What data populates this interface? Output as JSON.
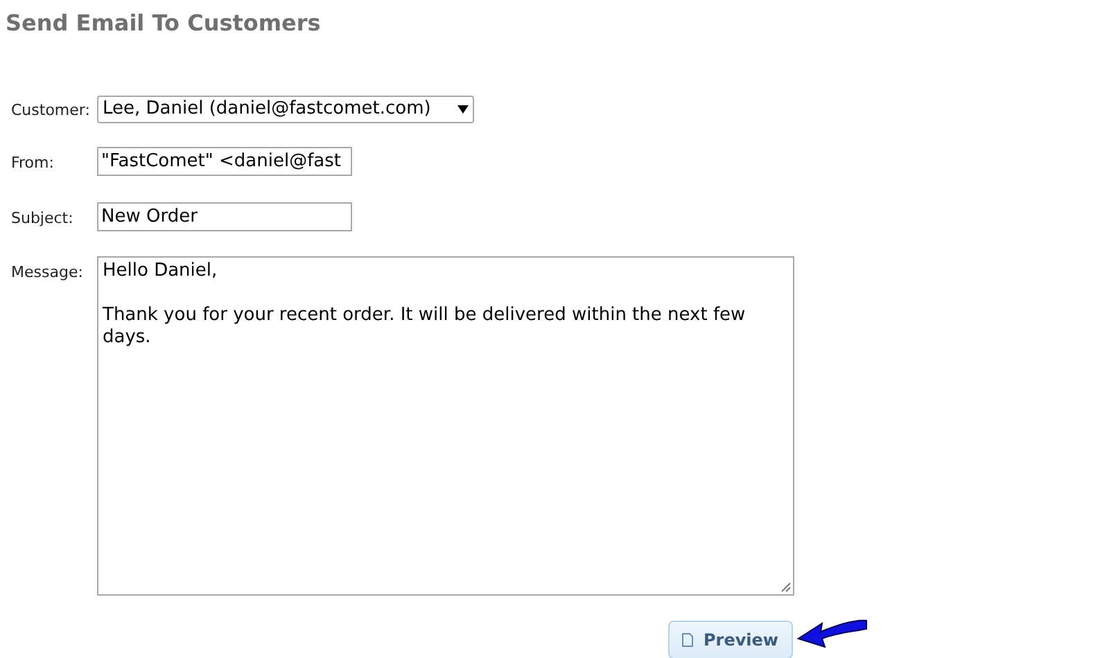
{
  "title": "Send Email To Customers",
  "fields": [
    {
      "kind": "select",
      "label": "Customer:",
      "value": "Lee, Daniel (daniel@fastcomet.com)"
    },
    {
      "kind": "text",
      "label": "From:",
      "value": "\"FastComet\" <daniel@fast"
    },
    {
      "kind": "text",
      "label": "Subject:",
      "value": "New Order"
    },
    {
      "kind": "textarea",
      "label": "Message:",
      "value": "Hello Daniel,\n\nThank you for your recent order. It will be delivered within the next few days."
    }
  ],
  "preview_button": "Preview"
}
